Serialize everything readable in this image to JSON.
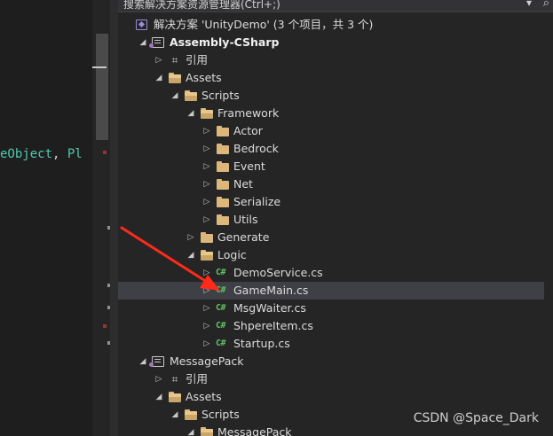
{
  "editor": {
    "code_type": "eObject",
    "code_punct": ", ",
    "code_type2": "Pl"
  },
  "search": {
    "placeholder": "搜索解决方案资源管理器(Ctrl+;)",
    "button_icon": "search-icon"
  },
  "tree": [
    {
      "label": "解决方案 'UnityDemo' (3 个项目，共 3 个)",
      "icon": "solution-icon",
      "arrow": "",
      "indent": 0,
      "bold": false,
      "selected": false
    },
    {
      "label": "Assembly-CSharp",
      "icon": "csharp-project-icon",
      "arrow": "expanded",
      "indent": 1,
      "bold": true,
      "selected": false
    },
    {
      "label": "引用",
      "icon": "references-icon",
      "arrow": "collapsed",
      "indent": 2,
      "bold": false,
      "selected": false
    },
    {
      "label": "Assets",
      "icon": "folder-open-icon",
      "arrow": "expanded",
      "indent": 2,
      "bold": false,
      "selected": false
    },
    {
      "label": "Scripts",
      "icon": "folder-open-icon",
      "arrow": "expanded",
      "indent": 3,
      "bold": false,
      "selected": false
    },
    {
      "label": "Framework",
      "icon": "folder-open-icon",
      "arrow": "expanded",
      "indent": 4,
      "bold": false,
      "selected": false
    },
    {
      "label": "Actor",
      "icon": "folder-icon",
      "arrow": "collapsed",
      "indent": 5,
      "bold": false,
      "selected": false
    },
    {
      "label": "Bedrock",
      "icon": "folder-icon",
      "arrow": "collapsed",
      "indent": 5,
      "bold": false,
      "selected": false
    },
    {
      "label": "Event",
      "icon": "folder-icon",
      "arrow": "collapsed",
      "indent": 5,
      "bold": false,
      "selected": false
    },
    {
      "label": "Net",
      "icon": "folder-icon",
      "arrow": "collapsed",
      "indent": 5,
      "bold": false,
      "selected": false
    },
    {
      "label": "Serialize",
      "icon": "folder-icon",
      "arrow": "collapsed",
      "indent": 5,
      "bold": false,
      "selected": false
    },
    {
      "label": "Utils",
      "icon": "folder-icon",
      "arrow": "collapsed",
      "indent": 5,
      "bold": false,
      "selected": false
    },
    {
      "label": "Generate",
      "icon": "folder-icon",
      "arrow": "collapsed",
      "indent": 4,
      "bold": false,
      "selected": false
    },
    {
      "label": "Logic",
      "icon": "folder-open-icon",
      "arrow": "expanded",
      "indent": 4,
      "bold": false,
      "selected": false
    },
    {
      "label": "DemoService.cs",
      "icon": "csharp-file-icon",
      "arrow": "collapsed",
      "indent": 5,
      "bold": false,
      "selected": false
    },
    {
      "label": "GameMain.cs",
      "icon": "csharp-file-icon",
      "arrow": "collapsed",
      "indent": 5,
      "bold": false,
      "selected": true
    },
    {
      "label": "MsgWaiter.cs",
      "icon": "csharp-file-icon",
      "arrow": "collapsed",
      "indent": 5,
      "bold": false,
      "selected": false
    },
    {
      "label": "ShpereItem.cs",
      "icon": "csharp-file-icon",
      "arrow": "collapsed",
      "indent": 5,
      "bold": false,
      "selected": false
    },
    {
      "label": "Startup.cs",
      "icon": "csharp-file-icon",
      "arrow": "collapsed",
      "indent": 5,
      "bold": false,
      "selected": false
    },
    {
      "label": "MessagePack",
      "icon": "csharp-project-icon",
      "arrow": "expanded",
      "indent": 1,
      "bold": false,
      "selected": false
    },
    {
      "label": "引用",
      "icon": "references-icon",
      "arrow": "collapsed",
      "indent": 2,
      "bold": false,
      "selected": false
    },
    {
      "label": "Assets",
      "icon": "folder-open-icon",
      "arrow": "expanded",
      "indent": 2,
      "bold": false,
      "selected": false
    },
    {
      "label": "Scripts",
      "icon": "folder-open-icon",
      "arrow": "expanded",
      "indent": 3,
      "bold": false,
      "selected": false
    },
    {
      "label": "MessagePack",
      "icon": "folder-open-icon",
      "arrow": "expanded",
      "indent": 4,
      "bold": false,
      "selected": false
    }
  ],
  "watermark": "CSDN @Space_Dark",
  "colors": {
    "panel_bg": "#252526",
    "editor_bg": "#1e1e1e",
    "selection": "#3f3f46",
    "folder": "#dcb67a",
    "csharp": "#60c060",
    "annotation_arrow": "#ff2a1a"
  }
}
